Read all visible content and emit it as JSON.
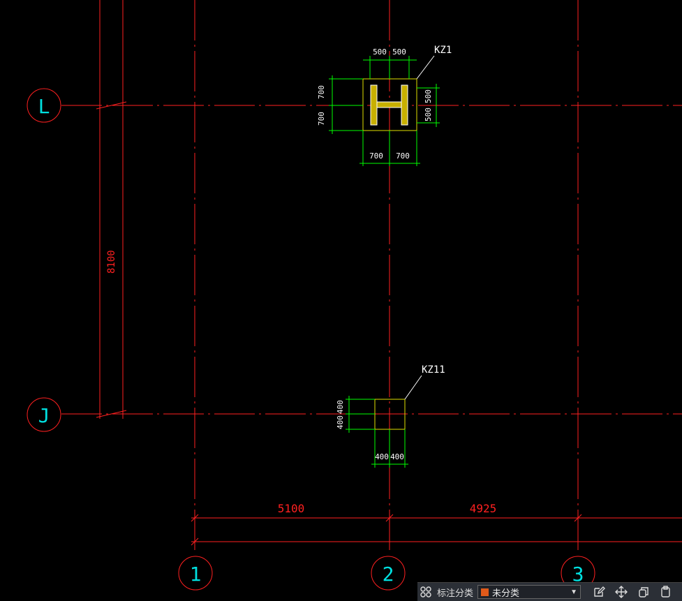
{
  "colors": {
    "background": "#000000",
    "axis_line": "#ff2020",
    "axis_label": "#00e0e0",
    "dimension": "#00ff00",
    "column_outline": "#e0e000",
    "white_text": "#ffffff",
    "category_swatch": "#e05a1a"
  },
  "axis_labels": {
    "L": "L",
    "J": "J",
    "one": "1",
    "two": "2",
    "three": "3"
  },
  "dimensions": {
    "left_vertical": "8100",
    "bay_1_2": "5100",
    "bay_2_3": "4925",
    "kz1_top_left": "500",
    "kz1_top_right": "500",
    "kz1_left_upper": "700",
    "kz1_left_lower": "700",
    "kz1_right_upper": "500",
    "kz1_right_lower": "500",
    "kz1_bottom_left": "700",
    "kz1_bottom_right": "700",
    "kz11_left_upper": "400",
    "kz11_left_lower": "400",
    "kz11_bottom_left": "400",
    "kz11_bottom_right": "400"
  },
  "columns": {
    "kz1_label": "KZ1",
    "kz11_label": "KZ11"
  },
  "toolbar": {
    "grid_icon": "grid-icon",
    "category_label": "标注分类",
    "category_value": "未分类",
    "dropdown_arrow": "▼",
    "tools": [
      "edit-icon",
      "move-icon",
      "copy-icon",
      "paste-icon"
    ]
  }
}
